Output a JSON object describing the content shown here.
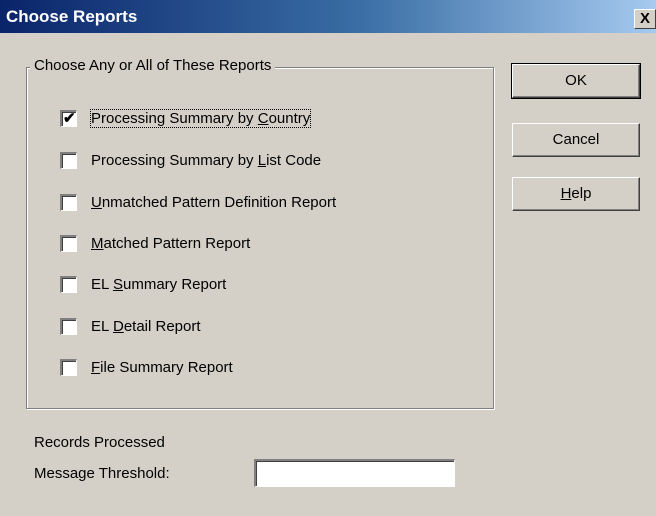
{
  "window": {
    "title": "Choose Reports",
    "close_glyph": "X"
  },
  "group": {
    "label": "Choose Any or All of These Reports",
    "items": [
      {
        "pre": "Processing Summary by ",
        "key": "C",
        "post": "ountry",
        "checked": true
      },
      {
        "pre": "Processing Summary by ",
        "key": "L",
        "post": "ist Code",
        "checked": false
      },
      {
        "pre": "",
        "key": "U",
        "post": "nmatched Pattern Definition Report",
        "checked": false
      },
      {
        "pre": "",
        "key": "M",
        "post": "atched Pattern Report",
        "checked": false
      },
      {
        "pre": "EL ",
        "key": "S",
        "post": "ummary Report",
        "checked": false
      },
      {
        "pre": "EL ",
        "key": "D",
        "post": "etail Report",
        "checked": false
      },
      {
        "pre": "",
        "key": "F",
        "post": "ile Summary Report",
        "checked": false
      }
    ]
  },
  "buttons": {
    "ok": "OK",
    "cancel": "Cancel",
    "help_key": "H",
    "help_rest": "elp"
  },
  "footer": {
    "records_processed": "Records Processed",
    "threshold_label": "Message Threshold:",
    "threshold_value": ""
  },
  "colors": {
    "face": "#d4d0c8",
    "title_start": "#0a246a",
    "title_end": "#a6caf0"
  }
}
